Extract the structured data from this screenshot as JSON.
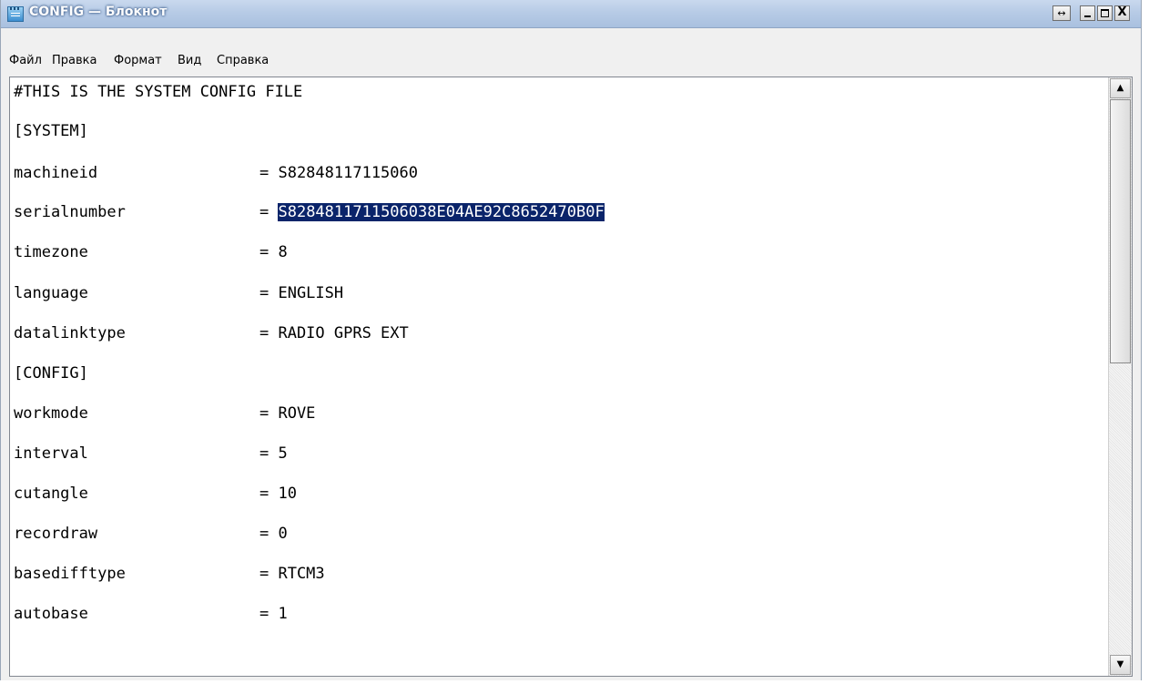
{
  "window": {
    "title": "CONFIG — Блокнот",
    "controls": {
      "arrows": "↔",
      "close": "X"
    }
  },
  "menu": [
    {
      "label": "Файл"
    },
    {
      "label": "Правка"
    },
    {
      "label": "Формат"
    },
    {
      "label": "Вид"
    },
    {
      "label": "Справка"
    }
  ],
  "document": {
    "lines": [
      {
        "text": "#THIS IS THE SYSTEM CONFIG FILE"
      },
      {
        "text": "[SYSTEM]"
      },
      {
        "key": "machineid",
        "value": "= S82848117115060"
      },
      {
        "key": "serialnumber",
        "value": "= ",
        "selected": "S8284811711506038E04AE92C8652470B0F"
      },
      {
        "key": "timezone",
        "value": "= 8"
      },
      {
        "key": "language",
        "value": "= ENGLISH"
      },
      {
        "key": "datalinktype",
        "value": "= RADIO GPRS EXT"
      },
      {
        "text": "[CONFIG]"
      },
      {
        "key": "workmode",
        "value": "= ROVE"
      },
      {
        "key": "interval",
        "value": "= 5"
      },
      {
        "key": "cutangle",
        "value": "= 10"
      },
      {
        "key": "recordraw",
        "value": "= 0"
      },
      {
        "key": "basedifftype",
        "value": "= RTCM3"
      },
      {
        "key": "autobase",
        "value": "= 1"
      }
    ]
  },
  "scrollbar": {
    "up_glyph": "▲",
    "down_glyph": "▼"
  }
}
